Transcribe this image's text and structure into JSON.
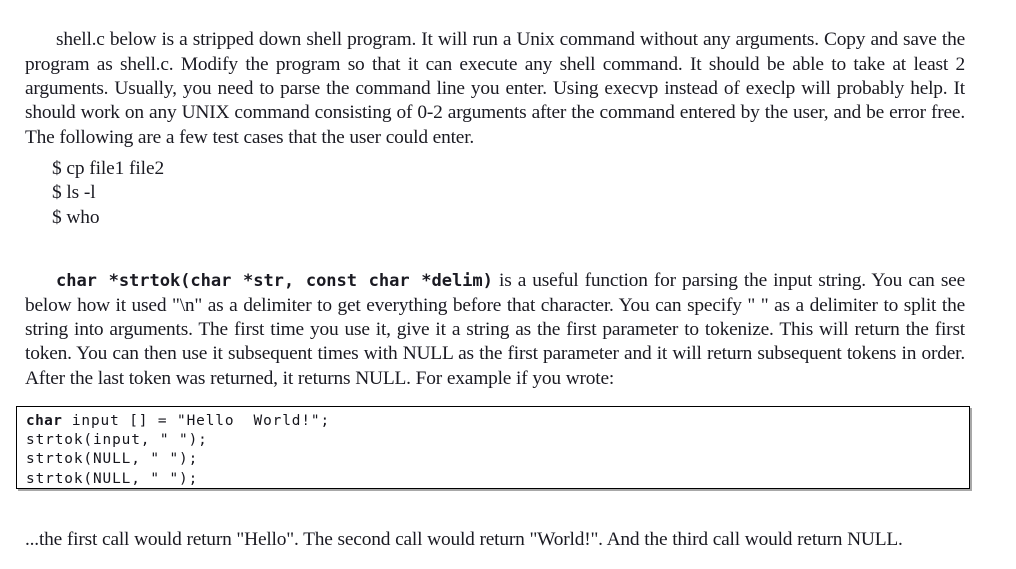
{
  "document": {
    "paragraphs": {
      "intro": "shell.c below is a stripped down shell program. It will run a Unix command without any arguments. Copy and save the program as shell.c. Modify the program so that it can execute any shell command. It should be able to take at least 2 arguments. Usually, you need to parse the command line you enter. Using execvp instead of execlp will probably help. It should work on any UNIX command consisting of 0-2 arguments after the command entered by the user, and be error free. The following are a few test cases that the user could enter.",
      "strtok_signature": "char *strtok(char *str, const char *delim)",
      "strtok_body": " is a useful function for parsing the input string. You can see below how it used \"\\n\" as a delimiter to get everything before that character. You can specify \" \" as a delimiter to split the string into arguments. The first time you use it, give it a string as the first parameter to tokenize. This will return the first token. You can then use it subsequent times with NULL as the first parameter and it will return subsequent tokens in order. After the last token was returned, it returns NULL. For example if you wrote:",
      "result": "...the first call would return \"Hello\".  The second call would return \"World!\".  And the third call would return NULL."
    },
    "command_list": {
      "line1": "$ cp file1 file2",
      "line2": "$ ls -l",
      "line3": "$ who"
    },
    "code_listing": {
      "line1_keyword": "char",
      "line1_rest": " input [] = \"Hello  World!\";",
      "line2": "strtok(input, \" \");",
      "line3": "strtok(NULL, \" \");",
      "line4": "strtok(NULL, \" \");"
    }
  }
}
